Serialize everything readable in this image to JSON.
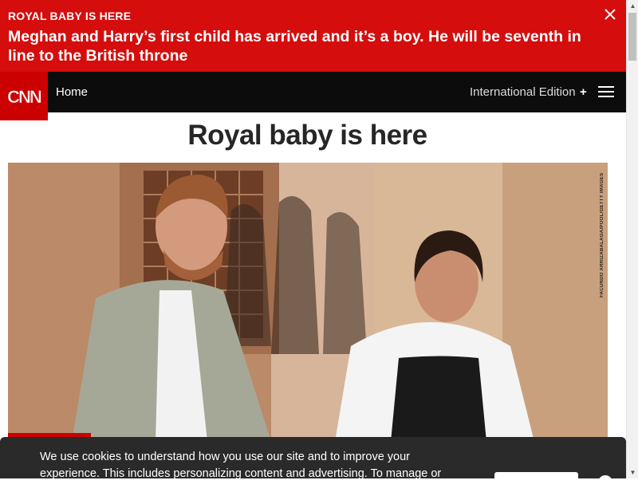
{
  "breaking": {
    "kicker": "ROYAL BABY IS HERE",
    "headline": "Meghan and Harry’s first child has arrived and it’s a boy. He will be seventh in line to the British throne"
  },
  "nav": {
    "logo_text": "CNN",
    "home_label": "Home",
    "edition_label": "International Edition",
    "edition_plus": "+"
  },
  "article": {
    "title": "Royal baby is here",
    "photo_credit": "FACUNDO ARRIZABALAGA/POOL/GETTY IMAGES"
  },
  "cookie": {
    "text": "We use cookies to understand how you use our site and to improve your experience. This includes personalizing content and advertising. To manage or"
  },
  "icons": {
    "close": "close-icon",
    "menu": "hamburger-menu-icon"
  },
  "colors": {
    "brand_red": "#cc0000",
    "breaking_red": "#d50d0d",
    "nav_black": "#0c0c0c"
  }
}
